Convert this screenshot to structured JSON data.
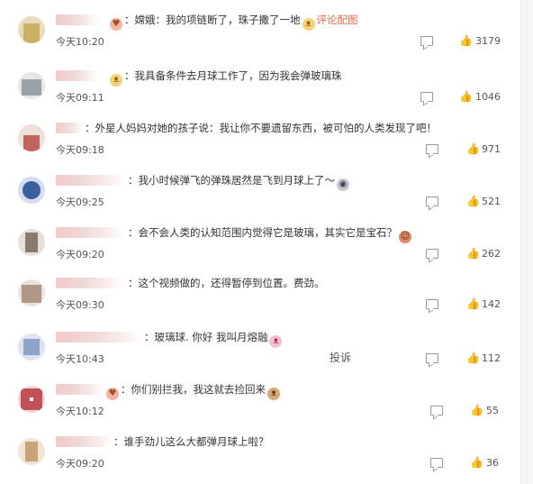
{
  "comments": [
    {
      "text": "：嫦娥：我的项链断了，珠子撒了一地",
      "extra": "评论配图",
      "time": "今天10:20",
      "likes": "3179",
      "avatar_color": "#c9b063"
    },
    {
      "text": "：我具备条件去月球工作了，因为我会弹玻璃珠",
      "time": "今天09:11",
      "likes": "1046",
      "avatar_color": "#9aa0a8"
    },
    {
      "text": "：外星人妈妈对她的孩子说：我让你不要遗留东西，被可怕的人类发现了吧！",
      "time": "今天09:18",
      "likes": "971",
      "avatar_color": "#c0665e"
    },
    {
      "text": "：我小时候弹飞的弹珠居然是飞到月球上了～",
      "time": "今天09:25",
      "likes": "521",
      "avatar_color": "#3a5f9c"
    },
    {
      "text": "：会不会人类的认知范围内觉得它是玻璃，其实它是宝石？",
      "time": "今天09:20",
      "likes": "262",
      "avatar_color": "#8a7a70"
    },
    {
      "text": "：这个视频做的，还得暂停到位置。费劲。",
      "time": "今天09:30",
      "likes": "142",
      "avatar_color": "#b09888"
    },
    {
      "text": "：玻璃球. 你好 我叫月熔融",
      "report": "投诉",
      "time": "今天10:43",
      "likes": "112",
      "avatar_color": "#8fa3c8"
    },
    {
      "text": "：你们别拦我，我这就去捡回来",
      "time": "今天10:12",
      "likes": "55",
      "avatar_color": "#c25058"
    },
    {
      "text": "：谁手劲儿这么大都弹月球上啦？",
      "time": "今天09:20",
      "likes": "36",
      "avatar_color": "#c8a478"
    }
  ]
}
